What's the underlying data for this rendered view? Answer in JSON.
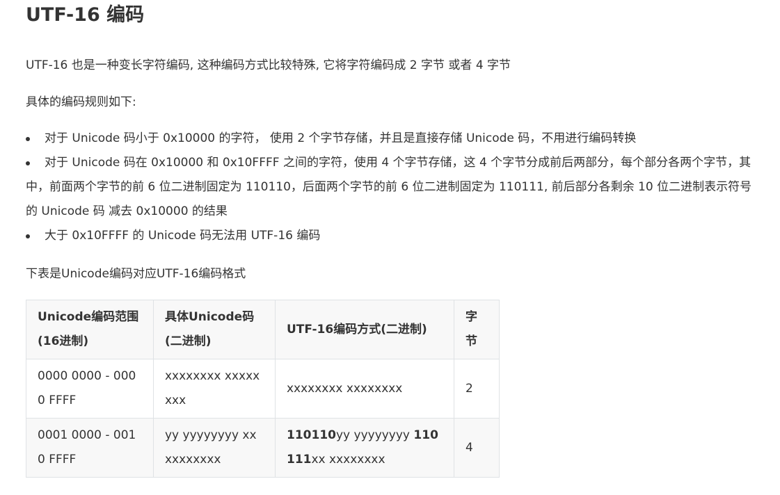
{
  "title": "UTF-16 编码",
  "intro": "UTF-16 也是一种变长字符编码, 这种编码方式比较特殊, 它将字符编码成 2 字节 或者 4 字节",
  "rules_heading": "具体的编码规则如下:",
  "rules": [
    "对于 Unicode 码小于 0x10000 的字符， 使用 2 个字节存储，并且是直接存储 Unicode 码，不用进行编码转换",
    "对于 Unicode 码在 0x10000 和 0x10FFFF 之间的字符，使用 4 个字节存储，这 4 个字节分成前后两部分，每个部分各两个字节，其中，前面两个字节的前 6 位二进制固定为 110110，后面两个字节的前 6 位二进制固定为 110111, 前后部分各剩余 10 位二进制表示符号的 Unicode 码 减去 0x10000 的结果",
    "大于 0x10FFFF 的 Unicode 码无法用 UTF-16 编码"
  ],
  "table_caption": "下表是Unicode编码对应UTF-16编码格式",
  "table": {
    "headers": [
      "Unicode编码范围(16进制)",
      "具体Unicode码(二进制)",
      "UTF-16编码方式(二进制)",
      "字节"
    ],
    "rows": [
      {
        "range": "0000 0000 - 0000 FFFF",
        "binary": "xxxxxxxx xxxxxxxx",
        "utf16_prefix1": "",
        "utf16_part1": "",
        "utf16_prefix2": "",
        "utf16_part2": "xxxxxxxx xxxxxxxx",
        "bytes": "2"
      },
      {
        "range": "0001 0000 - 0010 FFFF",
        "binary": "yy yyyyyyyy xx xxxxxxxx",
        "utf16_prefix1": "110110",
        "utf16_part1": "yy yyyyyyyy ",
        "utf16_prefix2": "110111",
        "utf16_part2": "xx xxxxxxxx",
        "bytes": "4"
      }
    ]
  }
}
